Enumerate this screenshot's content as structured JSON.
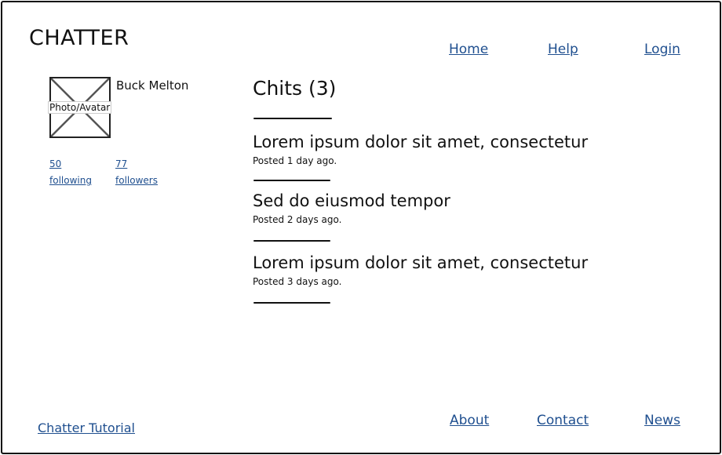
{
  "app": {
    "logo": "CHATTER"
  },
  "nav": {
    "home": "Home",
    "help": "Help",
    "login": "Login"
  },
  "profile": {
    "avatar_label": "Photo/Avatar",
    "name": "Buck Melton",
    "following_count": "50",
    "following_label": "following",
    "followers_count": "77",
    "followers_label": "followers"
  },
  "chits": {
    "heading": "Chits (3)",
    "items": [
      {
        "title": "Lorem ipsum dolor sit amet, consectetur",
        "meta": "Posted 1 day ago."
      },
      {
        "title": "Sed do eiusmod tempor",
        "meta": "Posted 2 days ago."
      },
      {
        "title": "Lorem ipsum dolor sit amet, consectetur",
        "meta": "Posted 3 days ago."
      }
    ]
  },
  "footer": {
    "tutorial": "Chatter Tutorial",
    "about": "About",
    "contact": "Contact",
    "news": "News"
  }
}
